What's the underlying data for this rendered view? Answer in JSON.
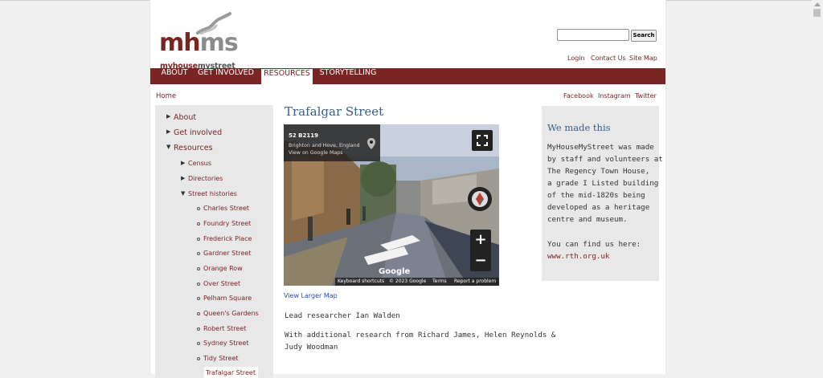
{
  "logo": {
    "word_a": "mh",
    "word_b": "ms",
    "tag_a": "myhouse",
    "tag_b": "mystreet"
  },
  "search": {
    "placeholder": "",
    "button_label": "Search"
  },
  "util_links": [
    "Login",
    "Contact Us",
    "Site Map"
  ],
  "nav": [
    {
      "label": "ABOUT",
      "active": false
    },
    {
      "label": "GET INVOLVED",
      "active": false
    },
    {
      "label": "RESOURCES",
      "active": true
    },
    {
      "label": "STORYTELLING",
      "active": false
    }
  ],
  "breadcrumb": "Home",
  "social": [
    "Facebook",
    "Instagram",
    "Twitter"
  ],
  "sidebar": {
    "about": "About",
    "get_involved": "Get involved",
    "resources": "Resources",
    "census": "Census",
    "directories": "Directories",
    "street_histories": "Street histories",
    "streets": [
      "Charles Street",
      "Foundry Street",
      "Frederick Place",
      "Gardner Street",
      "Orange Row",
      "Over Street",
      "Pelham Square",
      "Queen's Gardens",
      "Robert Street",
      "Sydney Street",
      "Tidy Street",
      "Trafalgar Street"
    ]
  },
  "main": {
    "title": "Trafalgar Street",
    "map": {
      "road": "52 B2119",
      "place": "Brighton and Hove, England",
      "view_link": "View on Google Maps",
      "google": "Google",
      "footer": [
        "Keyboard shortcuts",
        "© 2023 Google",
        "Terms",
        "Report a problem"
      ]
    },
    "map_link": "View Larger Map",
    "lead": "Lead researcher Ian Walden",
    "additional_1": "With additional research from Richard James, Helen Reynolds &",
    "additional_2": "Judy Woodman"
  },
  "aside": {
    "title": "We made this",
    "lines": [
      "MyHouseMyStreet was made",
      "by staff and volunteers at",
      "The Regency Town House,",
      "a grade I Listed building",
      "of the mid-1820s being",
      "developed as a heritage",
      "centre and museum."
    ],
    "find_us": "You can find us here:",
    "link": "www.rth.org.uk"
  },
  "colors": {
    "brand": "#7a2424",
    "heading_blue": "#365f8a",
    "panel_gray": "#e8e8e8"
  }
}
